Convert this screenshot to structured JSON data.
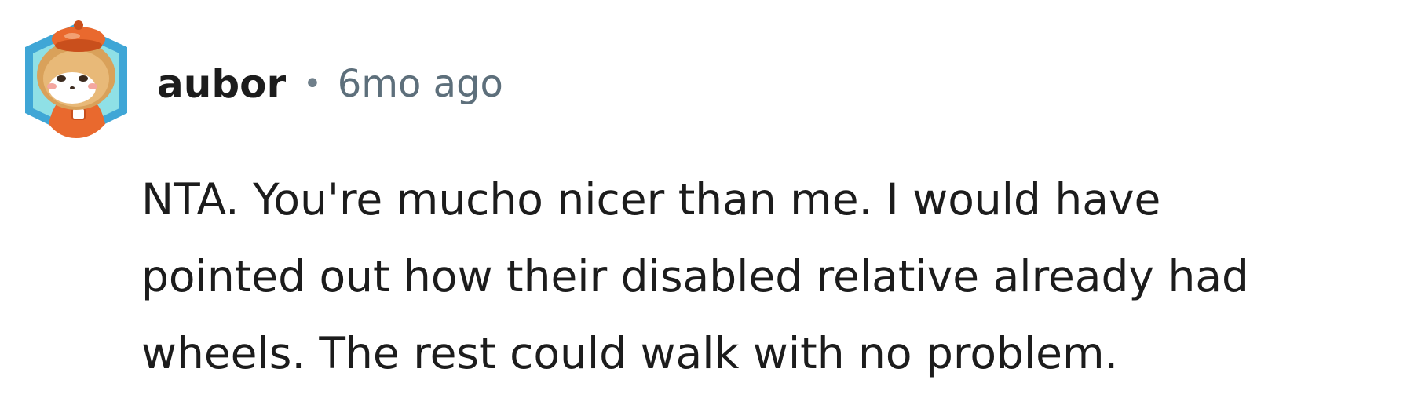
{
  "comment": {
    "author": "aubor",
    "separator": "•",
    "timestamp": "6mo ago",
    "avatar_icon": "hamster-avatar-icon",
    "body_lines": [
      "NTA. You're mucho nicer than me. I would have",
      "pointed out how their disabled relative already had",
      "wheels. The rest could walk with no problem."
    ]
  },
  "colors": {
    "author": "#1c1c1c",
    "meta": "#5d6f7b",
    "body": "#1c1c1c",
    "avatar_hex_outer": "#3fa6d6",
    "avatar_hex_inner": "#8fe0e6",
    "avatar_character": "#e9692e"
  }
}
